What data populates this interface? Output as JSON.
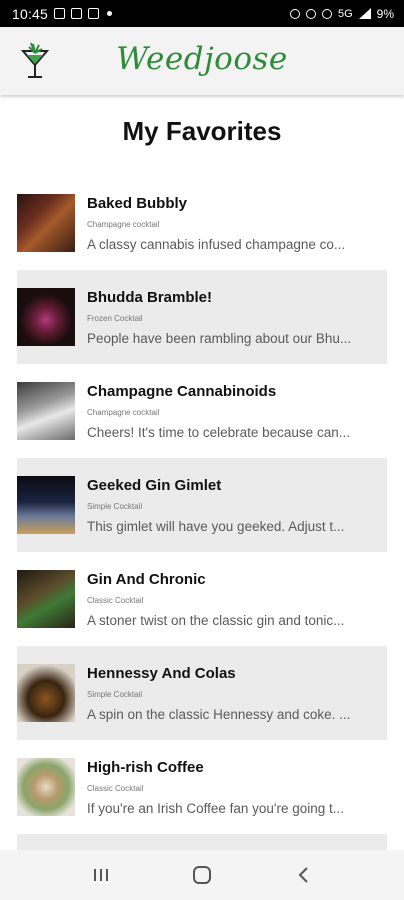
{
  "status_bar": {
    "time": "10:45",
    "network": "5G",
    "battery": "9%"
  },
  "app_bar": {
    "brand": "Weedjoose",
    "logo_icon": "cocktail-leaf-icon",
    "brand_color": "#2e8b3a"
  },
  "page": {
    "title": "My Favorites"
  },
  "favorites": [
    {
      "title": "Baked Bubbly",
      "category": "Champagne cocktail",
      "description": "A classy cannabis infused champagne co...",
      "shaded": false
    },
    {
      "title": "Bhudda Bramble!",
      "category": "Frozen Cocktail",
      "description": "People have been rambling about our Bhu...",
      "shaded": true
    },
    {
      "title": "Champagne Cannabinoids",
      "category": "Champagne cocktail",
      "description": "Cheers! It's time to celebrate because can...",
      "shaded": false
    },
    {
      "title": "Geeked Gin Gimlet",
      "category": "Simple Cocktail",
      "description": "This gimlet will have you geeked. Adjust t...",
      "shaded": true
    },
    {
      "title": "Gin And Chronic",
      "category": "Classic Cocktail",
      "description": "A stoner twist on the classic gin and tonic...",
      "shaded": false
    },
    {
      "title": "Hennessy And Colas",
      "category": "Simple Cocktail",
      "description": "A spin on the classic Hennessy and coke. ...",
      "shaded": true
    },
    {
      "title": "High-rish Coffee",
      "category": "Classic Cocktail",
      "description": "If you're an Irish Coffee fan you're going t...",
      "shaded": false
    }
  ],
  "nav_bar": {
    "recents_icon": "recents-icon",
    "home_icon": "home-icon",
    "back_icon": "back-icon"
  }
}
